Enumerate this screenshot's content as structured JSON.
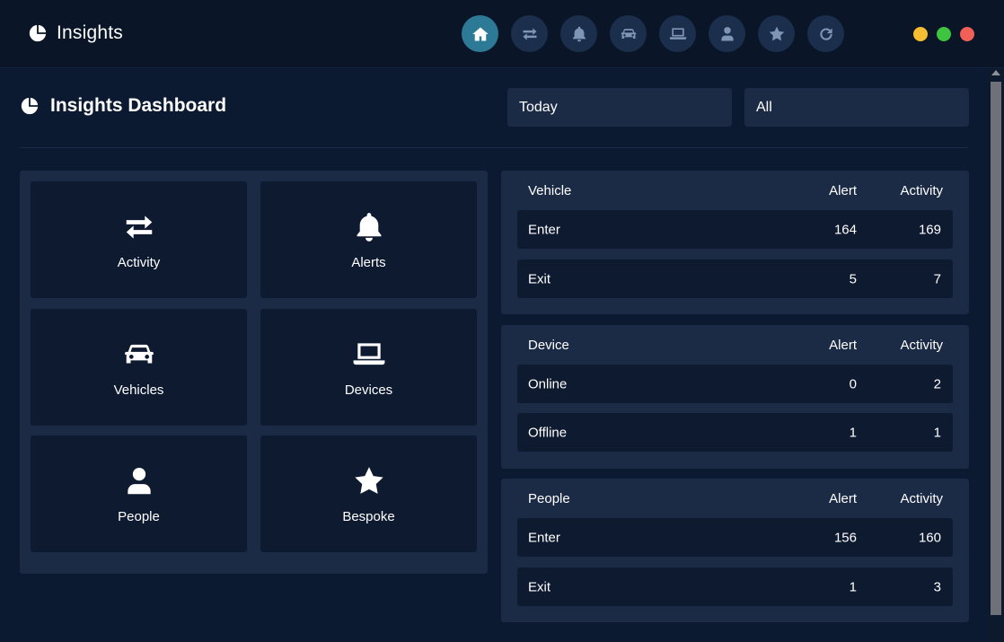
{
  "app": {
    "title": "Insights"
  },
  "nav": [
    {
      "icon": "home-icon",
      "active": true
    },
    {
      "icon": "transfer-icon",
      "active": false
    },
    {
      "icon": "bell-icon",
      "active": false
    },
    {
      "icon": "car-icon",
      "active": false
    },
    {
      "icon": "laptop-icon",
      "active": false
    },
    {
      "icon": "user-icon",
      "active": false
    },
    {
      "icon": "star-icon",
      "active": false
    },
    {
      "icon": "refresh-icon",
      "active": false
    }
  ],
  "window_controls": {
    "colors": [
      "#f5bd2f",
      "#3ec43f",
      "#f25f57"
    ]
  },
  "header": {
    "title": "Insights Dashboard",
    "time_filter": "Today",
    "scope_filter": "All"
  },
  "tiles": [
    {
      "label": "Activity",
      "icon": "transfer-icon"
    },
    {
      "label": "Alerts",
      "icon": "bell-icon"
    },
    {
      "label": "Vehicles",
      "icon": "car-icon"
    },
    {
      "label": "Devices",
      "icon": "laptop-icon"
    },
    {
      "label": "People",
      "icon": "user-icon"
    },
    {
      "label": "Bespoke",
      "icon": "star-icon"
    }
  ],
  "stats": {
    "vehicle": {
      "title": "Vehicle",
      "alert_header": "Alert",
      "activity_header": "Activity",
      "rows": [
        {
          "name": "Enter",
          "alert": "164",
          "activity": "169"
        },
        {
          "name": "Exit",
          "alert": "5",
          "activity": "7"
        }
      ]
    },
    "device": {
      "title": "Device",
      "alert_header": "Alert",
      "activity_header": "Activity",
      "rows": [
        {
          "name": "Online",
          "alert": "0",
          "activity": "2"
        },
        {
          "name": "Offline",
          "alert": "1",
          "activity": "1"
        }
      ]
    },
    "people": {
      "title": "People",
      "alert_header": "Alert",
      "activity_header": "Activity",
      "rows": [
        {
          "name": "Enter",
          "alert": "156",
          "activity": "160"
        },
        {
          "name": "Exit",
          "alert": "1",
          "activity": "3"
        }
      ]
    }
  }
}
